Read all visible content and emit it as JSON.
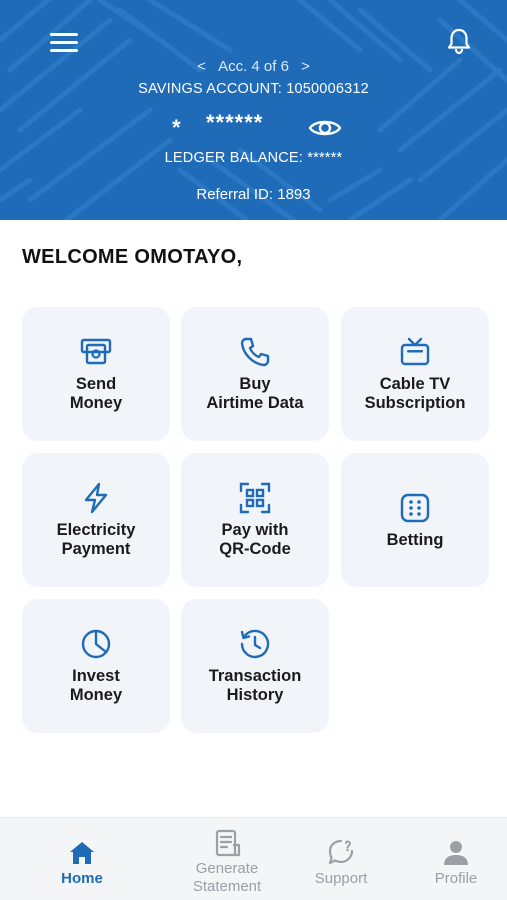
{
  "header": {
    "account_switch": {
      "prev": "<",
      "label": "Acc. 4 of 6",
      "next": ">"
    },
    "account_line": "SAVINGS ACCOUNT: 1050006312",
    "balance_currency": "*",
    "balance_masked": "******",
    "ledger_line": "LEDGER BALANCE: ******",
    "referral_line": "Referral ID: 1893",
    "background_color": "#1f6bb8"
  },
  "welcome": "WELCOME OMOTAYO,",
  "tiles": [
    {
      "line1": "Send",
      "line2": "Money",
      "icon": "money-transfer-icon"
    },
    {
      "line1": "Buy",
      "line2": "Airtime Data",
      "icon": "phone-icon"
    },
    {
      "line1": "Cable TV",
      "line2": "Subscription",
      "icon": "tv-icon"
    },
    {
      "line1": "Electricity",
      "line2": "Payment",
      "icon": "lightning-icon"
    },
    {
      "line1": "Pay with",
      "line2": "QR-Code",
      "icon": "qr-code-icon"
    },
    {
      "line1": "Betting",
      "line2": "",
      "icon": "dice-icon"
    },
    {
      "line1": "Invest",
      "line2": "Money",
      "icon": "pie-chart-icon"
    },
    {
      "line1": "Transaction",
      "line2": "History",
      "icon": "history-icon"
    }
  ],
  "bottom_nav": [
    {
      "line1": "Home",
      "line2": "",
      "icon": "home-icon",
      "active": true
    },
    {
      "line1": "Generate",
      "line2": "Statement",
      "icon": "statement-icon",
      "active": false
    },
    {
      "line1": "Support",
      "line2": "",
      "icon": "support-chat-icon",
      "active": false
    },
    {
      "line1": "Profile",
      "line2": "",
      "icon": "profile-icon",
      "active": false
    }
  ],
  "colors": {
    "accent": "#1f6bb8",
    "tile_bg": "#f1f4f8",
    "nav_inactive": "#9aa0a6"
  }
}
